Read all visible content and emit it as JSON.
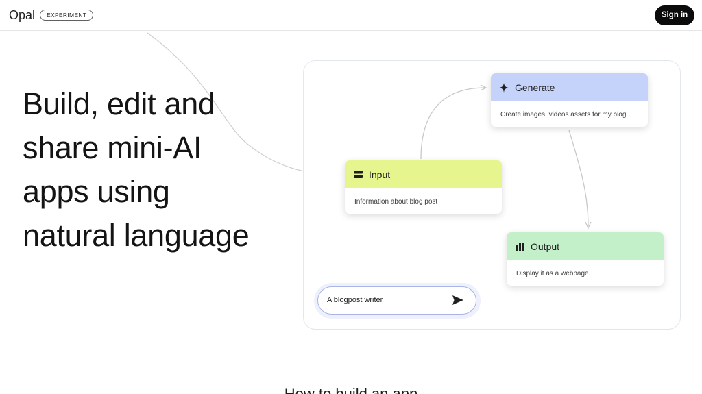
{
  "header": {
    "logo": "Opal",
    "badge": "EXPERIMENT",
    "signin_label": "Sign in"
  },
  "hero": {
    "lines": [
      "Build, edit and",
      "share mini-AI",
      "apps using",
      "natural language"
    ]
  },
  "nodes": {
    "generate": {
      "title": "Generate",
      "description": "Create images, videos assets for my blog",
      "icon": "sparkle-icon",
      "color": "#c5d3fb"
    },
    "input": {
      "title": "Input",
      "description": "Information about blog post",
      "icon": "input-icon",
      "color": "#e7f58f"
    },
    "output": {
      "title": "Output",
      "description": "Display it as a webpage",
      "icon": "chart-icon",
      "color": "#c4f0c9"
    }
  },
  "prompt": {
    "value": "A blogpost writer",
    "send_icon": "send-icon"
  },
  "section": {
    "heading": "How to build an app"
  }
}
